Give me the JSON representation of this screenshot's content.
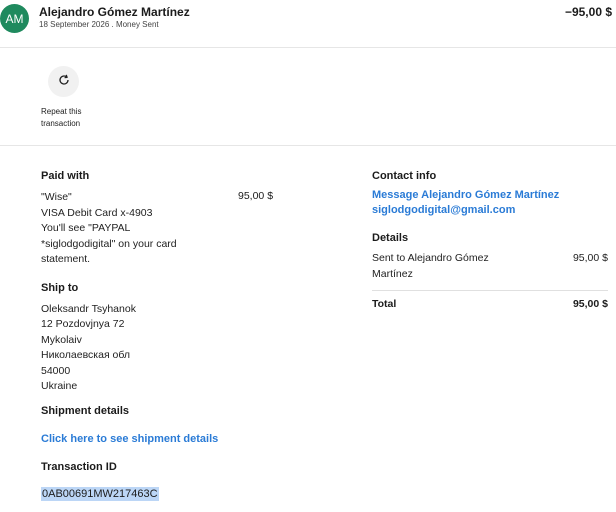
{
  "header": {
    "avatar_initials": "AM",
    "name": "Alejandro Gómez Martínez",
    "subline": "18 September 2026 . Money Sent",
    "amount": "−95,00 $"
  },
  "actions": {
    "repeat_label": "Repeat this transaction"
  },
  "paid_with": {
    "title": "Paid with",
    "lines": [
      "\"Wise\"",
      "VISA Debit Card x-4903",
      "You'll see \"PAYPAL *siglodgodigital\" on your card statement."
    ],
    "amount": "95,00 $"
  },
  "ship_to": {
    "title": "Ship to",
    "lines": [
      "Oleksandr Tsyhanok",
      "12 Pozdovjnya 72",
      "Mykolaiv",
      "Николаевская обл",
      "54000",
      "Ukraine"
    ]
  },
  "shipment": {
    "title": "Shipment details",
    "link": "Click here to see shipment details"
  },
  "transaction": {
    "title": "Transaction ID",
    "id": "0AB00691MW217463C"
  },
  "contact": {
    "title": "Contact info",
    "message_link": "Message Alejandro Gómez Martínez",
    "email": "siglodgodigital@gmail.com"
  },
  "details": {
    "title": "Details",
    "line_label": "Sent to Alejandro Gómez Martínez",
    "line_amount": "95,00 $",
    "total_label": "Total",
    "total_amount": "95,00 $"
  },
  "colors": {
    "avatar": "#1f8a5e",
    "link": "#2a7bd6",
    "highlight": "#bcd6f6"
  }
}
